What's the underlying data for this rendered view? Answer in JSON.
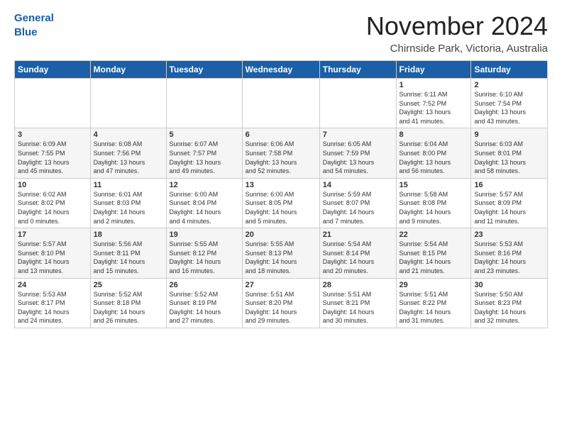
{
  "header": {
    "logo_line1": "General",
    "logo_line2": "Blue",
    "month": "November 2024",
    "location": "Chirnside Park, Victoria, Australia"
  },
  "weekdays": [
    "Sunday",
    "Monday",
    "Tuesday",
    "Wednesday",
    "Thursday",
    "Friday",
    "Saturday"
  ],
  "weeks": [
    [
      {
        "day": "",
        "info": ""
      },
      {
        "day": "",
        "info": ""
      },
      {
        "day": "",
        "info": ""
      },
      {
        "day": "",
        "info": ""
      },
      {
        "day": "",
        "info": ""
      },
      {
        "day": "1",
        "info": "Sunrise: 6:11 AM\nSunset: 7:52 PM\nDaylight: 13 hours\nand 41 minutes."
      },
      {
        "day": "2",
        "info": "Sunrise: 6:10 AM\nSunset: 7:54 PM\nDaylight: 13 hours\nand 43 minutes."
      }
    ],
    [
      {
        "day": "3",
        "info": "Sunrise: 6:09 AM\nSunset: 7:55 PM\nDaylight: 13 hours\nand 45 minutes."
      },
      {
        "day": "4",
        "info": "Sunrise: 6:08 AM\nSunset: 7:56 PM\nDaylight: 13 hours\nand 47 minutes."
      },
      {
        "day": "5",
        "info": "Sunrise: 6:07 AM\nSunset: 7:57 PM\nDaylight: 13 hours\nand 49 minutes."
      },
      {
        "day": "6",
        "info": "Sunrise: 6:06 AM\nSunset: 7:58 PM\nDaylight: 13 hours\nand 52 minutes."
      },
      {
        "day": "7",
        "info": "Sunrise: 6:05 AM\nSunset: 7:59 PM\nDaylight: 13 hours\nand 54 minutes."
      },
      {
        "day": "8",
        "info": "Sunrise: 6:04 AM\nSunset: 8:00 PM\nDaylight: 13 hours\nand 56 minutes."
      },
      {
        "day": "9",
        "info": "Sunrise: 6:03 AM\nSunset: 8:01 PM\nDaylight: 13 hours\nand 58 minutes."
      }
    ],
    [
      {
        "day": "10",
        "info": "Sunrise: 6:02 AM\nSunset: 8:02 PM\nDaylight: 14 hours\nand 0 minutes."
      },
      {
        "day": "11",
        "info": "Sunrise: 6:01 AM\nSunset: 8:03 PM\nDaylight: 14 hours\nand 2 minutes."
      },
      {
        "day": "12",
        "info": "Sunrise: 6:00 AM\nSunset: 8:04 PM\nDaylight: 14 hours\nand 4 minutes."
      },
      {
        "day": "13",
        "info": "Sunrise: 6:00 AM\nSunset: 8:05 PM\nDaylight: 14 hours\nand 5 minutes."
      },
      {
        "day": "14",
        "info": "Sunrise: 5:59 AM\nSunset: 8:07 PM\nDaylight: 14 hours\nand 7 minutes."
      },
      {
        "day": "15",
        "info": "Sunrise: 5:58 AM\nSunset: 8:08 PM\nDaylight: 14 hours\nand 9 minutes."
      },
      {
        "day": "16",
        "info": "Sunrise: 5:57 AM\nSunset: 8:09 PM\nDaylight: 14 hours\nand 11 minutes."
      }
    ],
    [
      {
        "day": "17",
        "info": "Sunrise: 5:57 AM\nSunset: 8:10 PM\nDaylight: 14 hours\nand 13 minutes."
      },
      {
        "day": "18",
        "info": "Sunrise: 5:56 AM\nSunset: 8:11 PM\nDaylight: 14 hours\nand 15 minutes."
      },
      {
        "day": "19",
        "info": "Sunrise: 5:55 AM\nSunset: 8:12 PM\nDaylight: 14 hours\nand 16 minutes."
      },
      {
        "day": "20",
        "info": "Sunrise: 5:55 AM\nSunset: 8:13 PM\nDaylight: 14 hours\nand 18 minutes."
      },
      {
        "day": "21",
        "info": "Sunrise: 5:54 AM\nSunset: 8:14 PM\nDaylight: 14 hours\nand 20 minutes."
      },
      {
        "day": "22",
        "info": "Sunrise: 5:54 AM\nSunset: 8:15 PM\nDaylight: 14 hours\nand 21 minutes."
      },
      {
        "day": "23",
        "info": "Sunrise: 5:53 AM\nSunset: 8:16 PM\nDaylight: 14 hours\nand 23 minutes."
      }
    ],
    [
      {
        "day": "24",
        "info": "Sunrise: 5:53 AM\nSunset: 8:17 PM\nDaylight: 14 hours\nand 24 minutes."
      },
      {
        "day": "25",
        "info": "Sunrise: 5:52 AM\nSunset: 8:18 PM\nDaylight: 14 hours\nand 26 minutes."
      },
      {
        "day": "26",
        "info": "Sunrise: 5:52 AM\nSunset: 8:19 PM\nDaylight: 14 hours\nand 27 minutes."
      },
      {
        "day": "27",
        "info": "Sunrise: 5:51 AM\nSunset: 8:20 PM\nDaylight: 14 hours\nand 29 minutes."
      },
      {
        "day": "28",
        "info": "Sunrise: 5:51 AM\nSunset: 8:21 PM\nDaylight: 14 hours\nand 30 minutes."
      },
      {
        "day": "29",
        "info": "Sunrise: 5:51 AM\nSunset: 8:22 PM\nDaylight: 14 hours\nand 31 minutes."
      },
      {
        "day": "30",
        "info": "Sunrise: 5:50 AM\nSunset: 8:23 PM\nDaylight: 14 hours\nand 32 minutes."
      }
    ]
  ]
}
